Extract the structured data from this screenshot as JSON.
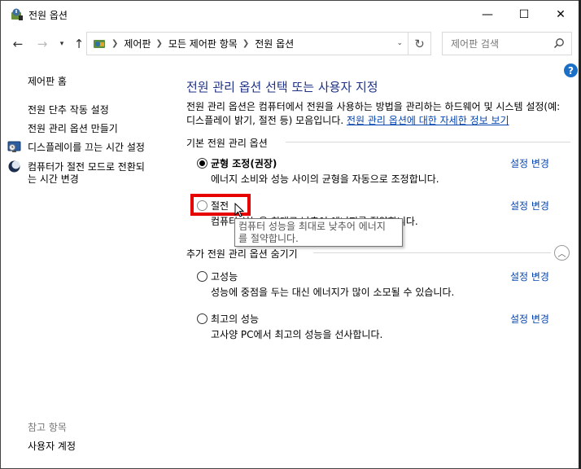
{
  "window": {
    "title": "전원 옵션",
    "controls": {
      "minimize": "—",
      "maximize": "☐",
      "close": "✕"
    }
  },
  "navbar": {
    "back": "←",
    "forward": "→",
    "up": "↑",
    "breadcrumb": [
      "제어판",
      "모든 제어판 항목",
      "전원 옵션"
    ],
    "refresh": "↻",
    "search_placeholder": "제어판 검색"
  },
  "help": "?",
  "sidebar": {
    "home": "제어판 홈",
    "items": [
      {
        "label": "전원 단추 작동 설정",
        "icon": "none"
      },
      {
        "label": "전원 관리 옵션 만들기",
        "icon": "none"
      },
      {
        "label": "디스플레이를 끄는 시간 설정",
        "icon": "monitor-icon"
      },
      {
        "label_line1": "컴퓨터가 절전 모드로 전환되",
        "label_line2": "는 시간 변경",
        "icon": "moon-icon"
      }
    ],
    "see_also": "참고 항목",
    "user_accounts": "사용자 계정"
  },
  "main": {
    "title": "전원 관리 옵션 선택 또는 사용자 지정",
    "description": "전원 관리 옵션은 컴퓨터에서 전원을 사용하는 방법을 관리하는 하드웨어 및 시스템 설정(예: 디스플레이 밝기, 절전 등) 모음입니다.",
    "description_link": "전원 관리 옵션에 대한 자세한 정보 보기",
    "basic_group": "기본 전원 관리 옵션",
    "hidden_group": "추가 전원 관리 옵션 숨기기",
    "plans": [
      {
        "name": "균형 조정(권장)",
        "desc": "에너지 소비와 성능 사이의 균형을 자동으로 조정합니다.",
        "link": "설정 변경",
        "selected": true
      },
      {
        "name": "절전",
        "desc": "컴퓨터 성능을 최대로 낮추어 에너지를 절약합니다.",
        "link": "설정 변경",
        "selected": false
      },
      {
        "name": "고성능",
        "desc": "성능에 중점을 두는 대신 에너지가 많이 소모될 수 있습니다.",
        "link": "설정 변경",
        "selected": false
      },
      {
        "name": "최고의 성능",
        "desc": "고사양 PC에서 최고의 성능을 선사합니다.",
        "link": "설정 변경",
        "selected": false
      }
    ],
    "tooltip_line1": "컴퓨터 성능을 최대로 낮추어 에너지",
    "tooltip_line2": "를 절약합니다."
  },
  "colors": {
    "title": "#1e3287",
    "link": "#0645ad",
    "highlight": "#e60000",
    "help": "#1c6fc6"
  }
}
